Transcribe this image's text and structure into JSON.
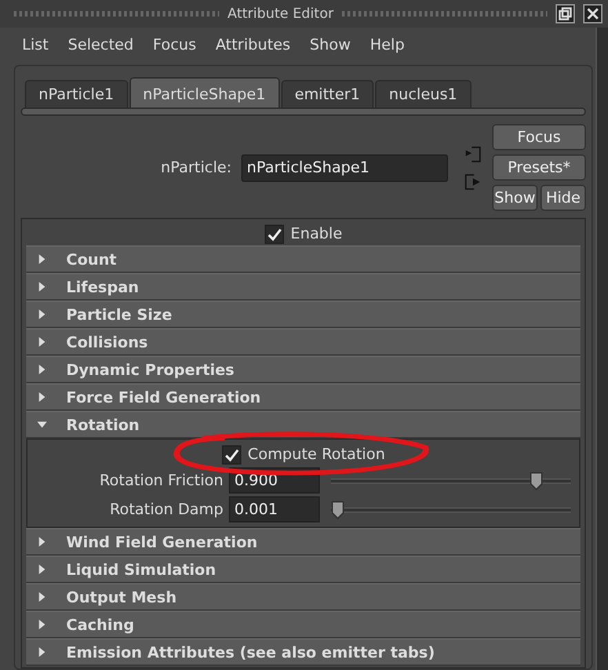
{
  "window": {
    "title": "Attribute Editor"
  },
  "menu": [
    "List",
    "Selected",
    "Focus",
    "Attributes",
    "Show",
    "Help"
  ],
  "tabs": [
    {
      "label": "nParticle1",
      "selected": false
    },
    {
      "label": "nParticleShape1",
      "selected": true
    },
    {
      "label": "emitter1",
      "selected": false
    },
    {
      "label": "nucleus1",
      "selected": false
    }
  ],
  "node": {
    "label": "nParticle:",
    "value": "nParticleShape1"
  },
  "buttons": {
    "focus": "Focus",
    "presets": "Presets*",
    "show": "Show",
    "hide": "Hide"
  },
  "enable": {
    "label": "Enable",
    "checked": true
  },
  "sections": [
    {
      "title": "Count",
      "expanded": false
    },
    {
      "title": "Lifespan",
      "expanded": false
    },
    {
      "title": "Particle Size",
      "expanded": false
    },
    {
      "title": "Collisions",
      "expanded": false
    },
    {
      "title": "Dynamic Properties",
      "expanded": false
    },
    {
      "title": "Force Field Generation",
      "expanded": false
    },
    {
      "title": "Rotation",
      "expanded": true,
      "checkbox": {
        "label": "Compute Rotation",
        "checked": true,
        "circled": true
      },
      "sliders": [
        {
          "label": "Rotation Friction",
          "value": "0.900",
          "level": 0.88
        },
        {
          "label": "Rotation Damp",
          "value": "0.001",
          "level": 0.0
        }
      ]
    },
    {
      "title": "Wind Field Generation",
      "expanded": false
    },
    {
      "title": "Liquid Simulation",
      "expanded": false
    },
    {
      "title": "Output Mesh",
      "expanded": false
    },
    {
      "title": "Caching",
      "expanded": false
    },
    {
      "title": "Emission Attributes (see also emitter tabs)",
      "expanded": false
    }
  ]
}
